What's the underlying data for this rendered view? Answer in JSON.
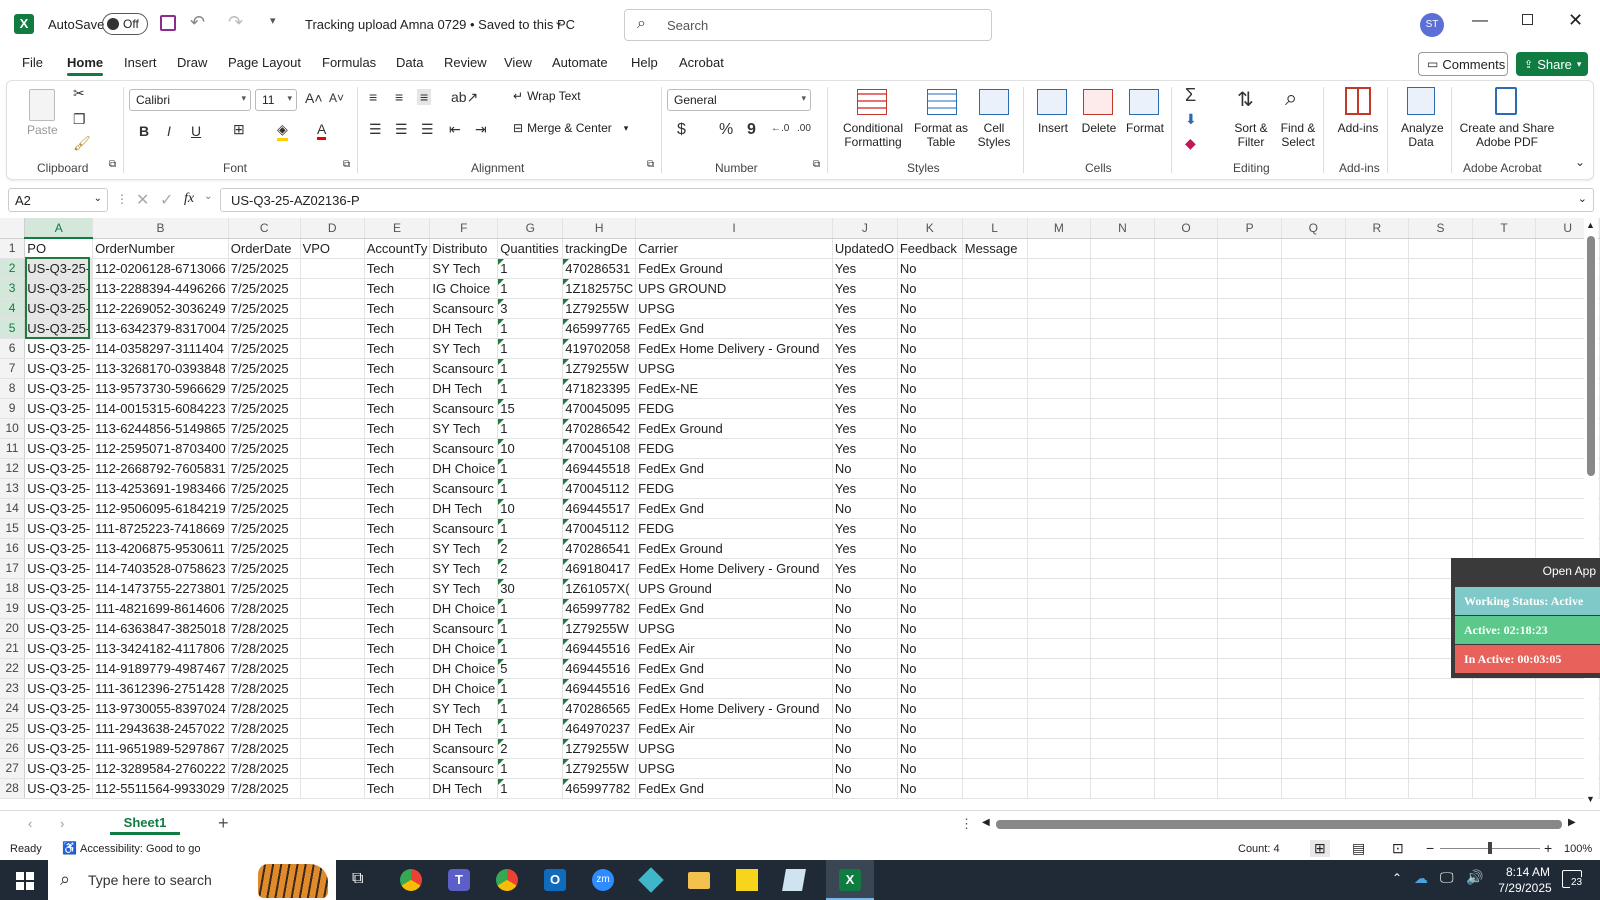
{
  "titlebar": {
    "autosave_label": "AutoSave",
    "autosave_state": "Off",
    "doc_title": "Tracking upload Amna 0729 • Saved to this PC",
    "search_placeholder": "Search",
    "avatar_initials": "ST"
  },
  "menu": {
    "items": [
      "File",
      "Home",
      "Insert",
      "Draw",
      "Page Layout",
      "Formulas",
      "Data",
      "Review",
      "View",
      "Automate",
      "Help",
      "Acrobat"
    ],
    "active": "Home",
    "comments_label": "Comments",
    "share_label": "Share"
  },
  "ribbon": {
    "clipboard": {
      "paste": "Paste",
      "label": "Clipboard"
    },
    "font": {
      "name": "Calibri",
      "size": "11",
      "label": "Font",
      "bold": "B",
      "italic": "I",
      "underline": "U"
    },
    "alignment": {
      "wrap": "Wrap Text",
      "merge": "Merge & Center",
      "label": "Alignment"
    },
    "number": {
      "format": "General",
      "label": "Number",
      "currency": "$",
      "percent": "%",
      "comma": "9"
    },
    "styles": {
      "conditional": "Conditional Formatting",
      "format_table": "Format as Table",
      "cell_styles": "Cell Styles",
      "label": "Styles"
    },
    "cells": {
      "insert": "Insert",
      "delete": "Delete",
      "format": "Format",
      "label": "Cells"
    },
    "editing": {
      "sort": "Sort & Filter",
      "find": "Find & Select",
      "label": "Editing"
    },
    "addins": {
      "addins": "Add-ins",
      "label": "Add-ins"
    },
    "analyze": {
      "label": "Analyze Data"
    },
    "acrobat": {
      "create": "Create and Share Adobe PDF",
      "label": "Adobe Acrobat"
    }
  },
  "formula_bar": {
    "name_box": "A2",
    "fx": "fx",
    "content": "US-Q3-25-AZ02136-P"
  },
  "grid": {
    "columns": [
      "A",
      "B",
      "C",
      "D",
      "E",
      "F",
      "G",
      "H",
      "I",
      "J",
      "K",
      "L",
      "M",
      "N",
      "O",
      "P",
      "Q",
      "R",
      "S",
      "T",
      "U"
    ],
    "headers": [
      "PO",
      "OrderNumber",
      "OrderDate",
      "VPO",
      "AccountTy",
      "Distributo",
      "Quantities",
      "trackingDe",
      "Carrier",
      "UpdatedO",
      "Feedback",
      "Message"
    ],
    "rows": [
      [
        "US-Q3-25-",
        "112-0206128-6713066",
        "7/25/2025",
        "",
        "Tech",
        "SY Tech",
        "1",
        "470286531",
        "FedEx Ground",
        "Yes",
        "No",
        ""
      ],
      [
        "US-Q3-25-",
        "113-2288394-4496266",
        "7/25/2025",
        "",
        "Tech",
        "IG Choice",
        "1",
        "1Z182575C",
        "UPS GROUND",
        "Yes",
        "No",
        ""
      ],
      [
        "US-Q3-25-",
        "112-2269052-3036249",
        "7/25/2025",
        "",
        "Tech",
        "Scansourc",
        "3",
        "1Z79255W",
        "UPSG",
        "Yes",
        "No",
        ""
      ],
      [
        "US-Q3-25-",
        "113-6342379-8317004",
        "7/25/2025",
        "",
        "Tech",
        "DH Tech",
        "1",
        "465997765",
        "FedEx Gnd",
        "Yes",
        "No",
        ""
      ],
      [
        "US-Q3-25-",
        "114-0358297-3111404",
        "7/25/2025",
        "",
        "Tech",
        "SY Tech",
        "1",
        "419702058",
        "FedEx Home Delivery - Ground",
        "Yes",
        "No",
        ""
      ],
      [
        "US-Q3-25-",
        "113-3268170-0393848",
        "7/25/2025",
        "",
        "Tech",
        "Scansourc",
        "1",
        "1Z79255W",
        "UPSG",
        "Yes",
        "No",
        ""
      ],
      [
        "US-Q3-25-",
        "113-9573730-5966629",
        "7/25/2025",
        "",
        "Tech",
        "DH Tech",
        "1",
        "471823395",
        "FedEx-NE",
        "Yes",
        "No",
        ""
      ],
      [
        "US-Q3-25-",
        "114-0015315-6084223",
        "7/25/2025",
        "",
        "Tech",
        "Scansourc",
        "15",
        "470045095",
        "FEDG",
        "Yes",
        "No",
        ""
      ],
      [
        "US-Q3-25-",
        "113-6244856-5149865",
        "7/25/2025",
        "",
        "Tech",
        "SY Tech",
        "1",
        "470286542",
        "FedEx Ground",
        "Yes",
        "No",
        ""
      ],
      [
        "US-Q3-25-",
        "112-2595071-8703400",
        "7/25/2025",
        "",
        "Tech",
        "Scansourc",
        "10",
        "470045108",
        "FEDG",
        "Yes",
        "No",
        ""
      ],
      [
        "US-Q3-25-",
        "112-2668792-7605831",
        "7/25/2025",
        "",
        "Tech",
        "DH Choice",
        "1",
        "469445518",
        "FedEx Gnd",
        "No",
        "No",
        ""
      ],
      [
        "US-Q3-25-",
        "113-4253691-1983466",
        "7/25/2025",
        "",
        "Tech",
        "Scansourc",
        "1",
        "470045112",
        "FEDG",
        "Yes",
        "No",
        ""
      ],
      [
        "US-Q3-25-",
        "112-9506095-6184219",
        "7/25/2025",
        "",
        "Tech",
        "DH Tech",
        "10",
        "469445517",
        "FedEx Gnd",
        "No",
        "No",
        ""
      ],
      [
        "US-Q3-25-",
        "111-8725223-7418669",
        "7/25/2025",
        "",
        "Tech",
        "Scansourc",
        "1",
        "470045112",
        "FEDG",
        "Yes",
        "No",
        ""
      ],
      [
        "US-Q3-25-",
        "113-4206875-9530611",
        "7/25/2025",
        "",
        "Tech",
        "SY Tech",
        "2",
        "470286541",
        "FedEx Ground",
        "Yes",
        "No",
        ""
      ],
      [
        "US-Q3-25-",
        "114-7403528-0758623",
        "7/25/2025",
        "",
        "Tech",
        "SY Tech",
        "2",
        "469180417",
        "FedEx Home Delivery - Ground",
        "Yes",
        "No",
        ""
      ],
      [
        "US-Q3-25-",
        "114-1473755-2273801",
        "7/25/2025",
        "",
        "Tech",
        "SY Tech",
        "30",
        "1Z61057X(",
        "UPS Ground",
        "No",
        "No",
        ""
      ],
      [
        "US-Q3-25-",
        "111-4821699-8614606",
        "7/28/2025",
        "",
        "Tech",
        "DH Choice",
        "1",
        "465997782",
        "FedEx Gnd",
        "No",
        "No",
        ""
      ],
      [
        "US-Q3-25-",
        "114-6363847-3825018",
        "7/28/2025",
        "",
        "Tech",
        "Scansourc",
        "1",
        "1Z79255W",
        "UPSG",
        "No",
        "No",
        ""
      ],
      [
        "US-Q3-25-",
        "113-3424182-4117806",
        "7/28/2025",
        "",
        "Tech",
        "DH Choice",
        "1",
        "469445516",
        "FedEx Air",
        "No",
        "No",
        ""
      ],
      [
        "US-Q3-25-",
        "114-9189779-4987467",
        "7/28/2025",
        "",
        "Tech",
        "DH Choice",
        "5",
        "469445516",
        "FedEx Gnd",
        "No",
        "No",
        ""
      ],
      [
        "US-Q3-25-",
        "111-3612396-2751428",
        "7/28/2025",
        "",
        "Tech",
        "DH Choice",
        "1",
        "469445516",
        "FedEx Gnd",
        "No",
        "No",
        ""
      ],
      [
        "US-Q3-25-",
        "113-9730055-8397024",
        "7/28/2025",
        "",
        "Tech",
        "SY Tech",
        "1",
        "470286565",
        "FedEx Home Delivery - Ground",
        "No",
        "No",
        ""
      ],
      [
        "US-Q3-25-",
        "111-2943638-2457022",
        "7/28/2025",
        "",
        "Tech",
        "DH Tech",
        "1",
        "464970237",
        "FedEx Air",
        "No",
        "No",
        ""
      ],
      [
        "US-Q3-25-",
        "111-9651989-5297867",
        "7/28/2025",
        "",
        "Tech",
        "Scansourc",
        "2",
        "1Z79255W",
        "UPSG",
        "No",
        "No",
        ""
      ],
      [
        "US-Q3-25-",
        "112-3289584-2760222",
        "7/28/2025",
        "",
        "Tech",
        "Scansourc",
        "1",
        "1Z79255W",
        "UPSG",
        "No",
        "No",
        ""
      ],
      [
        "US-Q3-25-",
        "112-5511564-9933029",
        "7/28/2025",
        "",
        "Tech",
        "DH Tech",
        "1",
        "465997782",
        "FedEx Gnd",
        "No",
        "No",
        ""
      ]
    ]
  },
  "sheet_tabs": {
    "active": "Sheet1",
    "add": "+"
  },
  "status": {
    "ready": "Ready",
    "accessibility": "Accessibility: Good to go",
    "count": "Count: 4",
    "zoom": "100%"
  },
  "widget": {
    "open_app": "Open App",
    "working_status": "Working Status: Active",
    "active": "Active: 02:18:23",
    "inactive": "In Active: 00:03:05"
  },
  "taskbar": {
    "search_placeholder": "Type here to search",
    "time": "8:14 AM",
    "date": "7/29/2025",
    "notif_count": "23"
  },
  "colors": {
    "excel_green": "#107c41",
    "selection_green": "#1e7b3d",
    "widget_teal": "#7fc9c9",
    "widget_green": "#5cc98a",
    "widget_red": "#e8615a"
  }
}
